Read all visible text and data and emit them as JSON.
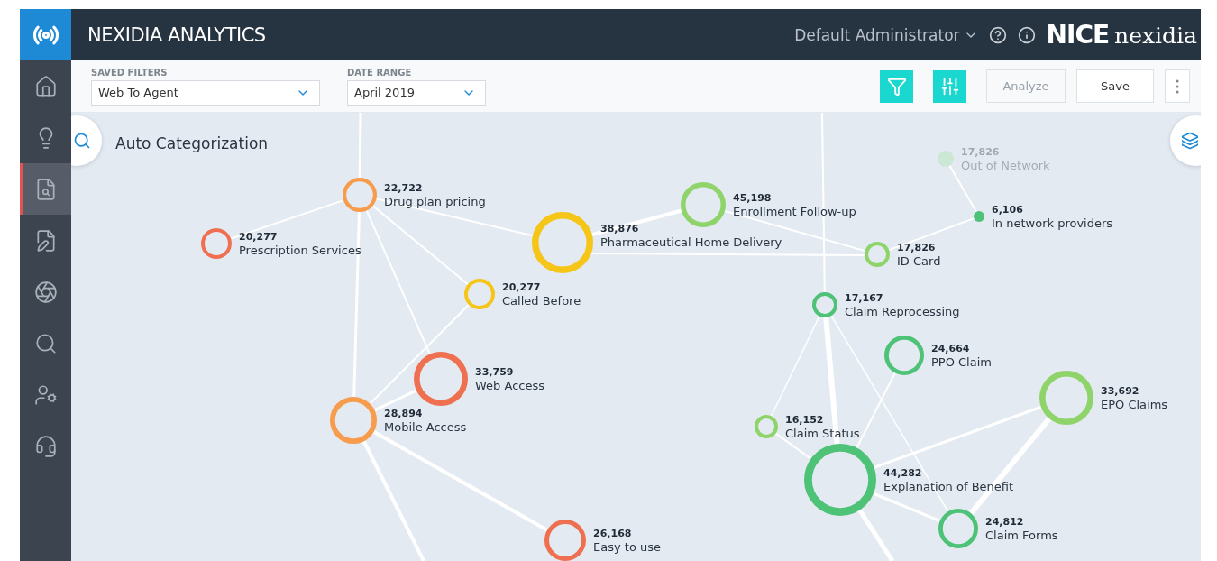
{
  "header": {
    "title": "NEXIDIA ANALYTICS",
    "user": "Default Administrator",
    "brand": {
      "mark": "NICE",
      "name": "nexidia"
    }
  },
  "sidebar": {
    "items": [
      {
        "selected": false
      },
      {
        "selected": false
      },
      {
        "selected": true
      },
      {
        "selected": false
      },
      {
        "selected": false
      },
      {
        "selected": false
      },
      {
        "selected": false
      },
      {
        "selected": false
      }
    ]
  },
  "toolbar": {
    "saved_filters": {
      "label": "SAVED FILTERS",
      "value": "Web To Agent"
    },
    "date_range": {
      "label": "DATE RANGE",
      "value": "April 2019"
    },
    "analyze": {
      "label": "Analyze",
      "disabled": true
    },
    "save": {
      "label": "Save",
      "disabled": false
    }
  },
  "canvas": {
    "title": "Auto Categorization",
    "nodes": [
      {
        "count": "22,722",
        "label": "Drug plan pricing",
        "color": "#f79b4d",
        "kind": "ring",
        "dimmed": false
      },
      {
        "count": "20,277",
        "label": "Prescription Services",
        "color": "#ee7050",
        "kind": "ring",
        "dimmed": false
      },
      {
        "count": "38,876",
        "label": "Pharmaceutical Home Delivery",
        "color": "#f5c518",
        "kind": "ring",
        "dimmed": false
      },
      {
        "count": "45,198",
        "label": "Enrollment Follow-up",
        "color": "#8fd46a",
        "kind": "ring",
        "dimmed": false
      },
      {
        "count": "20,277",
        "label": "Called Before",
        "color": "#f5c518",
        "kind": "ring",
        "dimmed": false
      },
      {
        "count": "33,759",
        "label": "Web Access",
        "color": "#ee7050",
        "kind": "ring",
        "dimmed": false
      },
      {
        "count": "28,894",
        "label": "Mobile Access",
        "color": "#f79b4d",
        "kind": "ring",
        "dimmed": false
      },
      {
        "count": "26,168",
        "label": "Easy to use",
        "color": "#ee7050",
        "kind": "ring",
        "dimmed": false
      },
      {
        "count": "17,826",
        "label": "Out of Network",
        "color": "#cbe8d4",
        "kind": "dot",
        "dimmed": true
      },
      {
        "count": "6,106",
        "label": "In network providers",
        "color": "#4ec276",
        "kind": "dot",
        "dimmed": false
      },
      {
        "count": "17,826",
        "label": "ID Card",
        "color": "#8fd46a",
        "kind": "ring",
        "dimmed": false
      },
      {
        "count": "17,167",
        "label": "Claim Reprocessing",
        "color": "#4ec276",
        "kind": "ring",
        "dimmed": false
      },
      {
        "count": "24,664",
        "label": "PPO Claim",
        "color": "#4ec276",
        "kind": "ring",
        "dimmed": false
      },
      {
        "count": "33,692",
        "label": "EPO Claims",
        "color": "#8fd46a",
        "kind": "ring",
        "dimmed": false
      },
      {
        "count": "16,152",
        "label": "Claim Status",
        "color": "#8fd46a",
        "kind": "ring",
        "dimmed": false
      },
      {
        "count": "44,282",
        "label": "Explanation of Benefit",
        "color": "#4ec276",
        "kind": "ring",
        "dimmed": false
      },
      {
        "count": "24,812",
        "label": "Claim Forms",
        "color": "#4ec276",
        "kind": "ring",
        "dimmed": false
      }
    ]
  }
}
